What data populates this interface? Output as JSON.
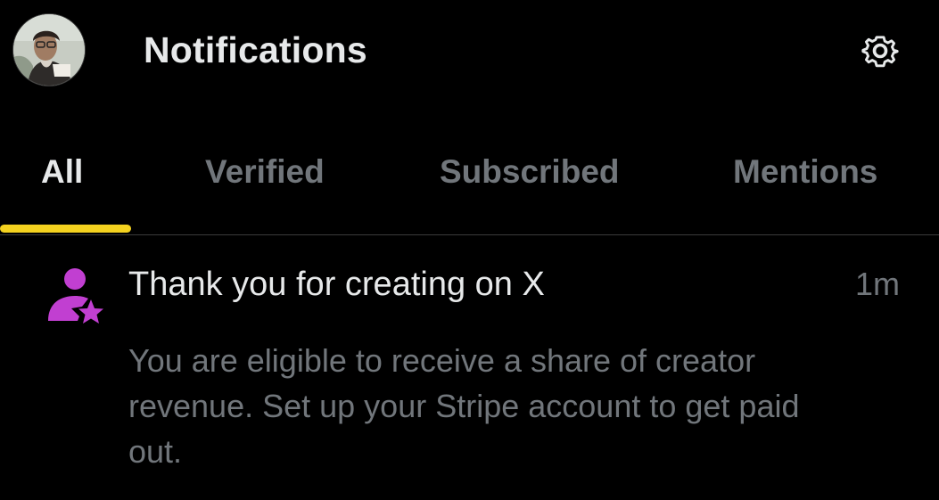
{
  "header": {
    "title": "Notifications",
    "avatar_icon": "user-photo-avatar",
    "settings_icon": "gear-icon"
  },
  "tabs": [
    {
      "label": "All",
      "active": true
    },
    {
      "label": "Verified",
      "active": false
    },
    {
      "label": "Subscribed",
      "active": false
    },
    {
      "label": "Mentions",
      "active": false
    }
  ],
  "notification": {
    "icon": "person-star-icon",
    "title": "Thank you for creating on X",
    "time": "1m",
    "body": "You are eligible to receive a share of creator revenue. Set up your Stripe account to get paid out."
  },
  "colors": {
    "background": "#000000",
    "primary_text": "#e7e9ea",
    "secondary_text": "#71767b",
    "active_tab_indicator": "#f4d21f",
    "icon_accent": "#c13fd1",
    "divider": "#3b3b3b"
  }
}
